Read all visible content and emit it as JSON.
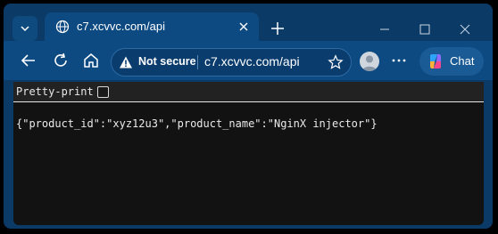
{
  "browser": {
    "tab": {
      "title": "c7.xcvvc.com/api",
      "favicon": "globe-icon"
    },
    "address_bar": {
      "security_label": "Not secure",
      "url": "c7.xcvvc.com/api"
    },
    "copilot_label": "Chat",
    "colors": {
      "frame": "#0b3a66",
      "toolbar": "#0d4a82",
      "content_bg": "#121212"
    }
  },
  "page": {
    "pretty_print_label": "Pretty-print",
    "pretty_print_checked": false,
    "json_text": "{\"product_id\":\"xyz12u3\",\"product_name\":\"NginX injector\"}"
  }
}
